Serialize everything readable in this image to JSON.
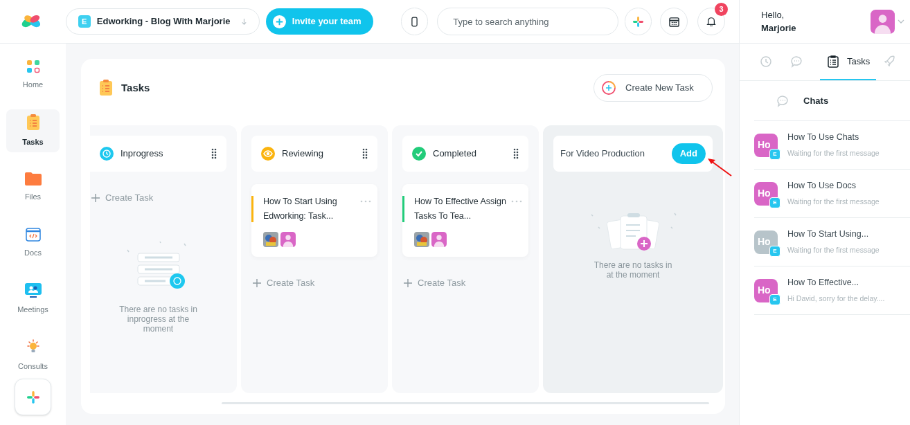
{
  "topbar": {
    "workspace": {
      "badge": "E",
      "name": "Edworking - Blog With Marjorie"
    },
    "invite_button": "Invite your team",
    "search": {
      "placeholder": "Type to search anything"
    },
    "notifications_count": "3"
  },
  "user": {
    "greeting": "Hello,",
    "name": "Marjorie"
  },
  "sidebar": {
    "items": [
      {
        "label": "Home",
        "kind": "home",
        "selected": false
      },
      {
        "label": "Tasks",
        "kind": "tasks",
        "selected": true
      },
      {
        "label": "Files",
        "kind": "files",
        "selected": false
      },
      {
        "label": "Docs",
        "kind": "docs",
        "selected": false
      },
      {
        "label": "Meetings",
        "kind": "meetings",
        "selected": false
      },
      {
        "label": "Consults",
        "kind": "consults",
        "selected": false
      }
    ]
  },
  "board": {
    "title": "Tasks",
    "create_button": "Create New Task",
    "columns": [
      {
        "kind": "status",
        "color": "#1ec8ef",
        "title": "Inprogress",
        "create_label": "Create Task",
        "empty_text": "There are no tasks in inprogress at the moment"
      },
      {
        "kind": "status",
        "color": "#fbb40f",
        "title": "Reviewing",
        "tasks": [
          {
            "title": "How To Start Using Edworking: Task...",
            "color": "#fbb40f"
          }
        ],
        "create_label": "Create Task"
      },
      {
        "kind": "status",
        "color": "#22cc7a",
        "title": "Completed",
        "tasks": [
          {
            "title": "How To Effective Assign Tasks To Tea...",
            "color": "#22cc7a"
          }
        ],
        "create_label": "Create Task"
      },
      {
        "kind": "group",
        "title": "For Video Production",
        "add_button": "Add",
        "empty_text": "There are no tasks in at the moment"
      }
    ]
  },
  "right_panel": {
    "tabs": [
      {
        "kind": "history",
        "selected": false
      },
      {
        "kind": "chat",
        "selected": false
      },
      {
        "kind": "tasks",
        "label": "Tasks",
        "selected": true
      },
      {
        "kind": "rocket",
        "selected": false
      }
    ],
    "section_title": "Chats",
    "chats": [
      {
        "avatar": "Ho",
        "badge": "E",
        "title": "How To Use Chats",
        "preview": "Waiting for the first message",
        "color": "#d966c6"
      },
      {
        "avatar": "Ho",
        "badge": "E",
        "title": "How To Use Docs",
        "preview": "Waiting for the first message",
        "color": "#d966c6"
      },
      {
        "avatar": "Ho",
        "badge": "E",
        "title": "How To Start Using...",
        "preview": "Waiting for the first message",
        "color": "#b7c4ca"
      },
      {
        "avatar": "Ho",
        "badge": "E",
        "title": "How To Effective...",
        "preview": "Hi David, sorry for the delay....",
        "color": "#d966c6"
      }
    ]
  }
}
